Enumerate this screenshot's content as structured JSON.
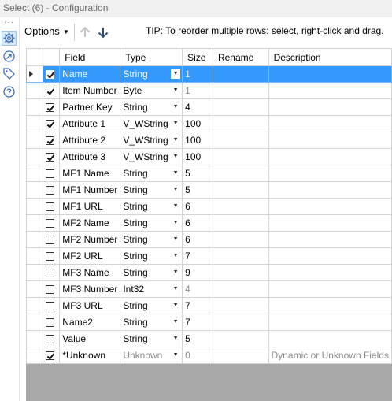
{
  "window": {
    "title": "Select (6) - Configuration"
  },
  "toolbar": {
    "options_label": "Options",
    "tip": "TIP: To reorder multiple rows: select, right-click and drag."
  },
  "side_icons": [
    "gear-icon",
    "tool-arrow-icon",
    "tag-icon",
    "help-icon"
  ],
  "grid": {
    "headers": {
      "field": "Field",
      "type": "Type",
      "size": "Size",
      "rename": "Rename",
      "description": "Description"
    },
    "rows": [
      {
        "checked": true,
        "field": "Name",
        "type": "String",
        "size": "1",
        "rename": "",
        "description": "",
        "selected": true,
        "size_muted": true
      },
      {
        "checked": true,
        "field": "Item Number",
        "type": "Byte",
        "size": "1",
        "rename": "",
        "description": "",
        "size_muted": true
      },
      {
        "checked": true,
        "field": "Partner Key",
        "type": "String",
        "size": "4",
        "rename": "",
        "description": ""
      },
      {
        "checked": true,
        "field": "Attribute 1",
        "type": "V_WString",
        "size": "100",
        "rename": "",
        "description": ""
      },
      {
        "checked": true,
        "field": "Attribute 2",
        "type": "V_WString",
        "size": "100",
        "rename": "",
        "description": ""
      },
      {
        "checked": true,
        "field": "Attribute 3",
        "type": "V_WString",
        "size": "100",
        "rename": "",
        "description": ""
      },
      {
        "checked": false,
        "field": "MF1 Name",
        "type": "String",
        "size": "5",
        "rename": "",
        "description": ""
      },
      {
        "checked": false,
        "field": "MF1 Number",
        "type": "String",
        "size": "5",
        "rename": "",
        "description": ""
      },
      {
        "checked": false,
        "field": "MF1 URL",
        "type": "String",
        "size": "6",
        "rename": "",
        "description": ""
      },
      {
        "checked": false,
        "field": "MF2 Name",
        "type": "String",
        "size": "6",
        "rename": "",
        "description": ""
      },
      {
        "checked": false,
        "field": "MF2 Number",
        "type": "String",
        "size": "6",
        "rename": "",
        "description": ""
      },
      {
        "checked": false,
        "field": "MF2 URL",
        "type": "String",
        "size": "7",
        "rename": "",
        "description": ""
      },
      {
        "checked": false,
        "field": "MF3 Name",
        "type": "String",
        "size": "9",
        "rename": "",
        "description": ""
      },
      {
        "checked": false,
        "field": "MF3 Number",
        "type": "Int32",
        "size": "4",
        "rename": "",
        "description": "",
        "size_muted": true
      },
      {
        "checked": false,
        "field": "MF3 URL",
        "type": "String",
        "size": "7",
        "rename": "",
        "description": ""
      },
      {
        "checked": false,
        "field": "Name2",
        "type": "String",
        "size": "7",
        "rename": "",
        "description": ""
      },
      {
        "checked": false,
        "field": "Value",
        "type": "String",
        "size": "5",
        "rename": "",
        "description": ""
      },
      {
        "checked": true,
        "field": "*Unknown",
        "type": "Unknown",
        "size": "0",
        "rename": "",
        "description": "Dynamic or Unknown Fields",
        "type_muted": true,
        "size_muted": true,
        "desc_muted": true
      }
    ]
  },
  "colors": {
    "selection": "#3399ff",
    "grid_bg": "#a9a9a9",
    "title_bg": "#f0f0f0"
  }
}
